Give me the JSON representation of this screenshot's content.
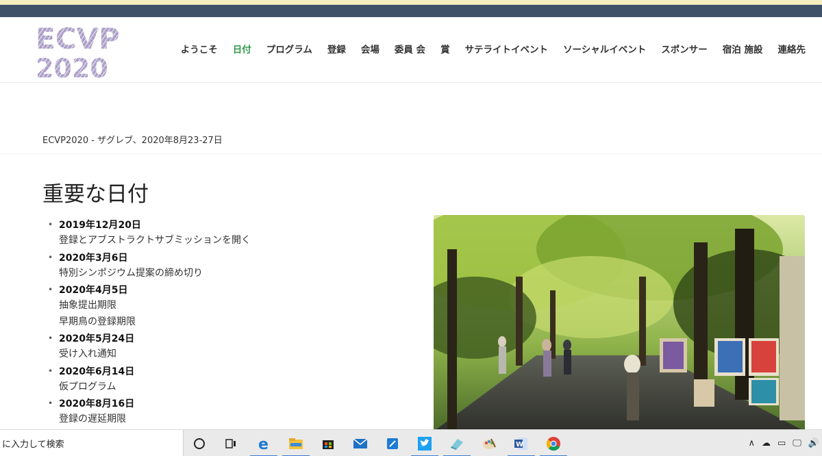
{
  "header": {
    "logo_line1": "ECVP",
    "logo_line2": "2020"
  },
  "nav": {
    "items": [
      {
        "label": "ようこそ"
      },
      {
        "label": "日付"
      },
      {
        "label": "プログラム"
      },
      {
        "label": "登録"
      },
      {
        "label": "会場"
      },
      {
        "label": "委員 会"
      },
      {
        "label": "賞"
      },
      {
        "label": "サテライトイベント"
      },
      {
        "label": "ソーシャルイベント"
      },
      {
        "label": "スポンサー"
      },
      {
        "label": "宿泊 施設"
      },
      {
        "label": "連絡先"
      }
    ],
    "active_index": 1,
    "active_color": "#2d9a47"
  },
  "breadcrumb": "ECVP2020 - ザグレブ、2020年8月23-27日",
  "page_title": "重要な日付",
  "dates": [
    {
      "date": "2019年12月20日",
      "lines": [
        "登録とアブストラクトサブミッションを開く"
      ]
    },
    {
      "date": "2020年3月6日",
      "lines": [
        "特別シンポジウム提案の締め切り"
      ]
    },
    {
      "date": "2020年4月5日",
      "lines": [
        "抽象提出期限",
        "早期鳥の登録期限"
      ]
    },
    {
      "date": "2020年5月24日",
      "lines": [
        "受け入れ通知"
      ]
    },
    {
      "date": "2020年6月14日",
      "lines": [
        "仮プログラム"
      ]
    },
    {
      "date": "2020年8月16日",
      "lines": [
        "登録の遅延期限"
      ]
    }
  ],
  "taskbar": {
    "search_placeholder": "に入力して検索",
    "icons": [
      "cortana-icon",
      "task-view-icon",
      "edge-icon",
      "file-explorer-icon",
      "store-icon",
      "mail-icon",
      "app-icon",
      "twitter-icon",
      "notes-icon",
      "paint-icon",
      "word-icon",
      "chrome-icon"
    ]
  },
  "colors": {
    "top_bar": "#3f5168",
    "top_strip": "#f6edbf",
    "taskbar": "#eaeaea"
  }
}
